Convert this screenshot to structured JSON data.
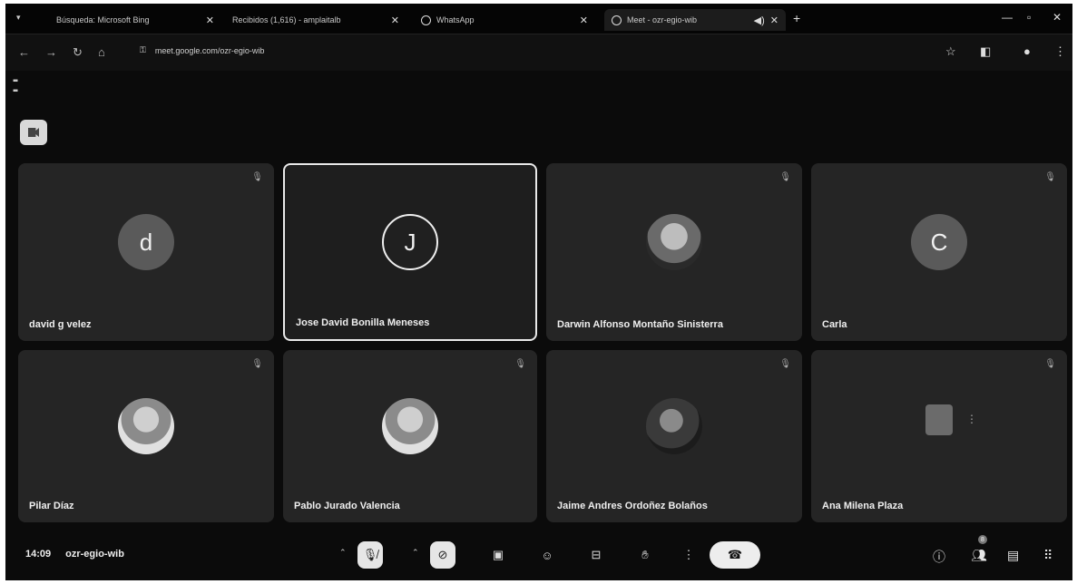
{
  "browser": {
    "tabs": [
      {
        "label": "Búsqueda: Microsoft Bing"
      },
      {
        "label": "Recibidos (1,616) - amplaitalb"
      },
      {
        "label": "WhatsApp"
      },
      {
        "label": "Meet - ozr-egio-wib"
      }
    ],
    "url": "meet.google.com/ozr-egio-wib"
  },
  "meeting": {
    "time": "14:09",
    "code": "ozr-egio-wib",
    "people_badge": "8"
  },
  "participants": [
    {
      "name": "david g velez",
      "initial": "d"
    },
    {
      "name": "Jose David Bonilla Meneses",
      "initial": "J"
    },
    {
      "name": "Darwin Alfonso Montaño Sinisterra"
    },
    {
      "name": "Carla",
      "initial": "C"
    },
    {
      "name": "Pilar Díaz"
    },
    {
      "name": "Pablo Jurado Valencia"
    },
    {
      "name": "Jaime Andres Ordoñez Bolaños"
    },
    {
      "name": "Ana Milena Plaza"
    }
  ]
}
